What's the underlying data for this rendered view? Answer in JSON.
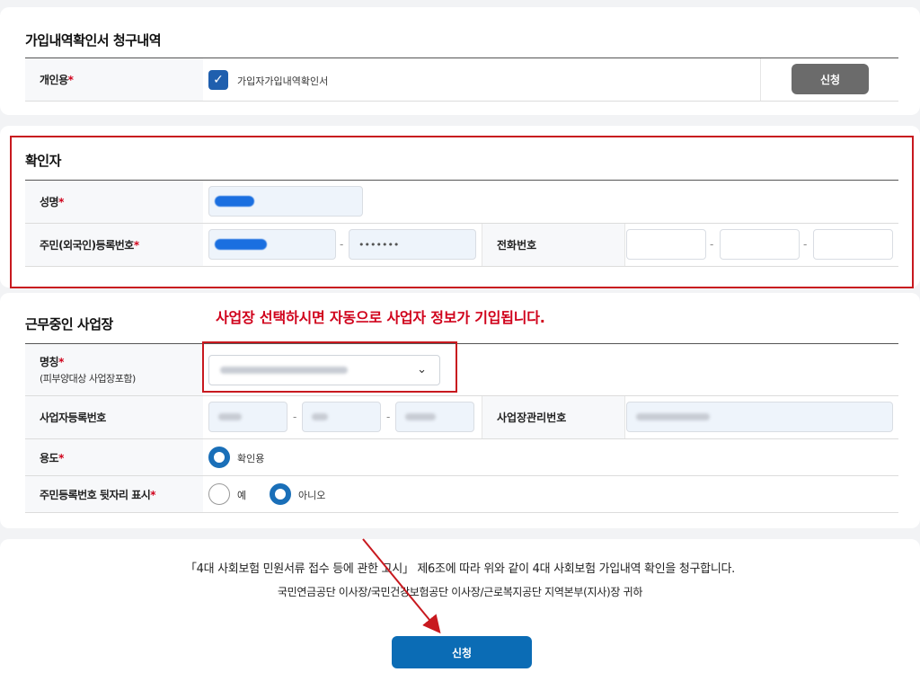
{
  "sections": {
    "request": {
      "title": "가입내역확인서 청구내역",
      "row_label": "개인용",
      "checkbox_label": "가입자가입내역확인서",
      "checkbox_checked": true,
      "apply_label": "신청"
    },
    "confirmer": {
      "title": "확인자",
      "name_label": "성명",
      "rrn_label": "주민(외국인)등록번호",
      "rrn_back_masked": "•••••••",
      "phone_label": "전화번호"
    },
    "workplace": {
      "title": "근무중인 사업장",
      "notice": "사업장 선택하시면 자동으로 사업자 정보가 기입됩니다.",
      "name_label": "명칭",
      "name_sublabel": "(피부양대상 사업장포함)",
      "biz_reg_label": "사업자등록번호",
      "biz_mgmt_label": "사업장관리번호",
      "purpose_label": "용도",
      "purpose_option": "확인용",
      "rrn_show_label": "주민등록번호 뒷자리 표시",
      "rrn_show_options": [
        "예",
        "아니오"
      ],
      "rrn_show_selected": "아니오"
    }
  },
  "required_mark": "*",
  "dash": "-",
  "declaration": {
    "line1": "「4대 사회보험 민원서류 접수 등에 관한 고시」 제6조에 따라 위와 같이 4대 사회보험 가입내역 확인을 청구합니다.",
    "line2": "국민연금공단 이사장/국민건강보험공단 이사장/근로복지공단 지역본부(지사)장 귀하",
    "submit_label": "신청"
  },
  "colors": {
    "primary_blue": "#0b6cb5",
    "annotation_red": "#c8191f",
    "gray_button": "#6b6b6b"
  }
}
